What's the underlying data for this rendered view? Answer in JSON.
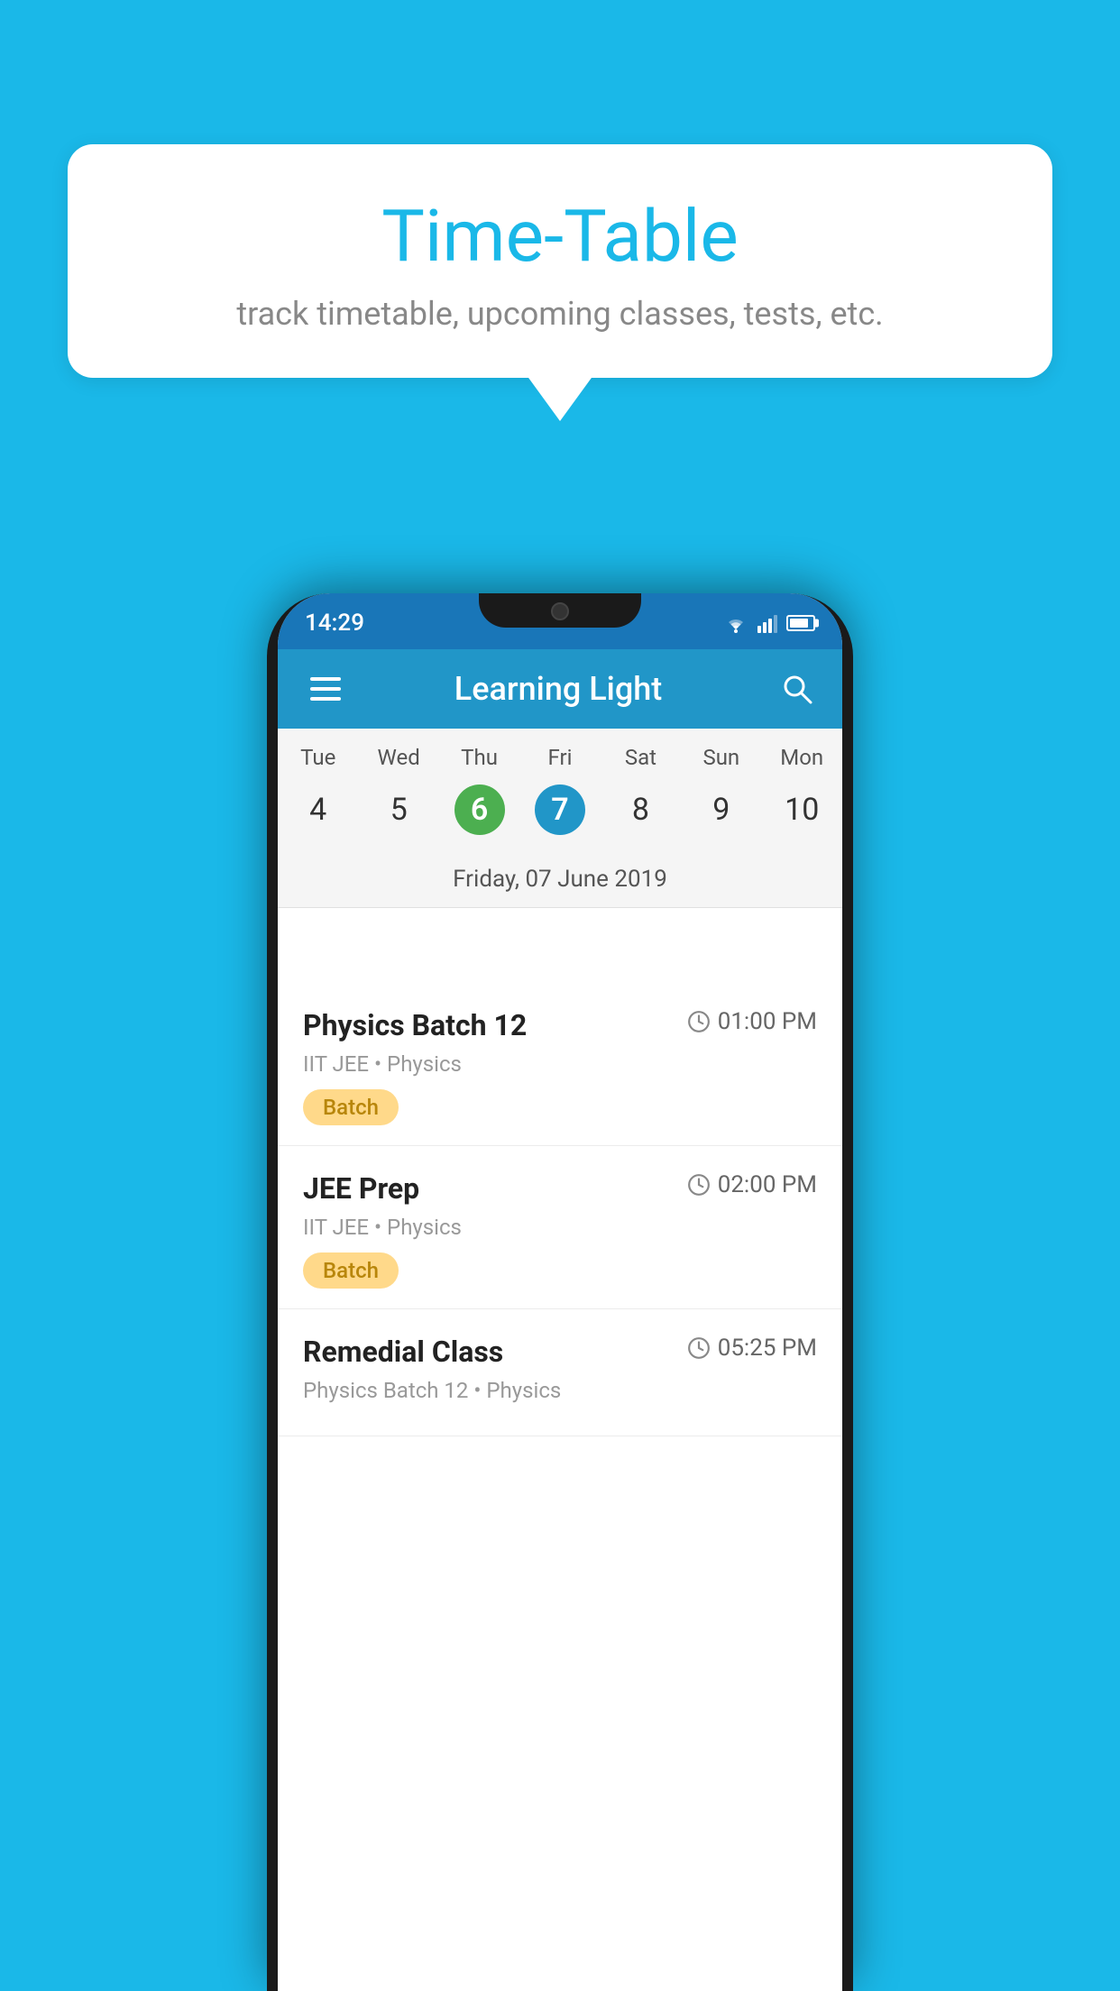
{
  "background": {
    "color": "#1ab8e8"
  },
  "tooltip": {
    "title": "Time-Table",
    "subtitle": "track timetable, upcoming classes, tests, etc."
  },
  "phone": {
    "statusBar": {
      "time": "14:29"
    },
    "appHeader": {
      "title": "Learning Light",
      "hamburger_label": "menu",
      "search_label": "search"
    },
    "calendar": {
      "days": [
        {
          "short": "Tue",
          "num": "4"
        },
        {
          "short": "Wed",
          "num": "5"
        },
        {
          "short": "Thu",
          "num": "6",
          "state": "today"
        },
        {
          "short": "Fri",
          "num": "7",
          "state": "selected"
        },
        {
          "short": "Sat",
          "num": "8"
        },
        {
          "short": "Sun",
          "num": "9"
        },
        {
          "short": "Mon",
          "num": "10"
        }
      ],
      "selectedDate": "Friday, 07 June 2019"
    },
    "schedule": [
      {
        "name": "Physics Batch 12",
        "time": "01:00 PM",
        "meta": "IIT JEE • Physics",
        "tag": "Batch"
      },
      {
        "name": "JEE Prep",
        "time": "02:00 PM",
        "meta": "IIT JEE • Physics",
        "tag": "Batch"
      },
      {
        "name": "Remedial Class",
        "time": "05:25 PM",
        "meta": "Physics Batch 12 • Physics",
        "tag": null
      }
    ]
  }
}
